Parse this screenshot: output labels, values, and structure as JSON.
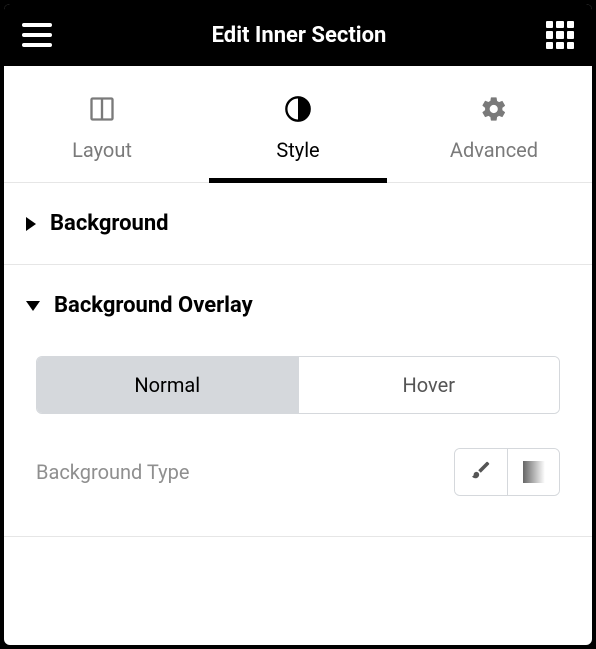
{
  "header": {
    "title": "Edit Inner Section"
  },
  "tabs": {
    "layout": {
      "label": "Layout"
    },
    "style": {
      "label": "Style"
    },
    "advanced": {
      "label": "Advanced"
    }
  },
  "sections": {
    "background": {
      "title": "Background"
    },
    "background_overlay": {
      "title": "Background Overlay",
      "subtabs": {
        "normal": "Normal",
        "hover": "Hover"
      },
      "background_type_label": "Background Type"
    }
  }
}
